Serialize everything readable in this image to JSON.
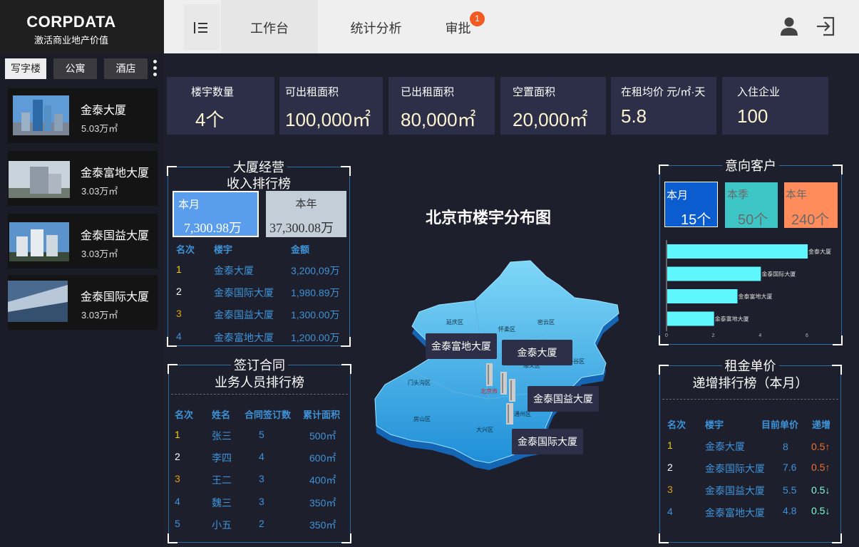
{
  "brand": {
    "title": "CORPDATA",
    "subtitle": "激活商业地产价值"
  },
  "categories": [
    "写字楼",
    "公寓",
    "酒店"
  ],
  "buildings": [
    {
      "name": "金泰大厦",
      "area": "5.03万㎡"
    },
    {
      "name": "金泰富地大厦",
      "area": "3.03万㎡"
    },
    {
      "name": "金泰国益大厦",
      "area": "3.03万㎡"
    },
    {
      "name": "金泰国际大厦",
      "area": "3.03万㎡"
    }
  ],
  "nav": {
    "work": "工作台",
    "stats": "统计分析",
    "approve": "审批",
    "badge": "1"
  },
  "icons": {
    "menu": "menu-fold-icon",
    "user": "user-icon",
    "logout": "logout-icon"
  },
  "stats": [
    {
      "label": "楼宇数量",
      "value": "4个"
    },
    {
      "label": "可出租面积",
      "value": "100,000㎡"
    },
    {
      "label": "已出租面积",
      "value": "80,000㎡"
    },
    {
      "label": "空置面积",
      "value": "20,000㎡"
    },
    {
      "label": "在租均价 元/㎡·天",
      "value": "5.8"
    },
    {
      "label": "入住企业",
      "value": "100"
    }
  ],
  "income": {
    "title1": "大厦经营",
    "title2": "收入排行榜",
    "month_label": "本月",
    "month_value": "7,300.98万",
    "year_label": "本年",
    "year_value": "37,300.08万",
    "headers": [
      "名次",
      "楼宇",
      "金额"
    ],
    "rows": [
      {
        "rank": "1",
        "name": "金泰大厦",
        "amount": "3,200,09万"
      },
      {
        "rank": "2",
        "name": "金泰国际大厦",
        "amount": "1,980.89万"
      },
      {
        "rank": "3",
        "name": "金泰国益大厦",
        "amount": "1,300.00万"
      },
      {
        "rank": "4",
        "name": "金泰富地大厦",
        "amount": "1,200.00万"
      }
    ]
  },
  "contracts": {
    "title1": "签订合同",
    "title2": "业务人员排行榜",
    "headers": [
      "名次",
      "姓名",
      "合同签订数",
      "累计面积"
    ],
    "rows": [
      {
        "rank": "1",
        "name": "张三",
        "count": "5",
        "area": "500㎡"
      },
      {
        "rank": "2",
        "name": "李四",
        "count": "4",
        "area": "600㎡"
      },
      {
        "rank": "3",
        "name": "王二",
        "count": "3",
        "area": "400㎡"
      },
      {
        "rank": "4",
        "name": "魏三",
        "count": "3",
        "area": "350㎡"
      },
      {
        "rank": "5",
        "name": "小五",
        "count": "2",
        "area": "350㎡"
      }
    ]
  },
  "map": {
    "title": "北京市楼宇分布图",
    "tags": [
      "金泰富地大厦",
      "金泰大厦",
      "金泰国益大厦",
      "金泰国际大厦"
    ],
    "districts": [
      "延庆区",
      "怀柔区",
      "密云区",
      "平谷区",
      "门头沟区",
      "房山区",
      "大兴区",
      "北京市",
      "顺义区",
      "通州区"
    ]
  },
  "clients": {
    "title": "意向客户",
    "month_label": "本月",
    "month_value": "15个",
    "quarter_label": "本季",
    "quarter_value": "50个",
    "year_label": "本年",
    "year_value": "240个",
    "colors": {
      "month": "#0b5ccf",
      "quarter": "#3ec6c6",
      "year": "#ff8c5a",
      "bar": "#5ef7ff"
    }
  },
  "chart_data": {
    "type": "bar",
    "orientation": "horizontal",
    "categories": [
      "金泰大厦",
      "金泰国际大厦",
      "金泰富地大厦",
      "金泰富地大厦"
    ],
    "values": [
      6,
      4,
      3,
      2
    ],
    "xlim": [
      0,
      6
    ],
    "xticks": [
      "0",
      "2",
      "4",
      "6"
    ]
  },
  "rent": {
    "title1": "租金单价",
    "title2": "递增排行榜（本月）",
    "headers": [
      "名次",
      "楼宇",
      "目前单价",
      "递增"
    ],
    "rows": [
      {
        "rank": "1",
        "name": "金泰大厦",
        "price": "8",
        "inc": "0.5↑"
      },
      {
        "rank": "2",
        "name": "金泰国际大厦",
        "price": "7.6",
        "inc": "0.5↑"
      },
      {
        "rank": "3",
        "name": "金泰国益大厦",
        "price": "5.5",
        "inc": "0.5↓"
      },
      {
        "rank": "4",
        "name": "金泰富地大厦",
        "price": "4.8",
        "inc": "0.5↓"
      }
    ]
  }
}
